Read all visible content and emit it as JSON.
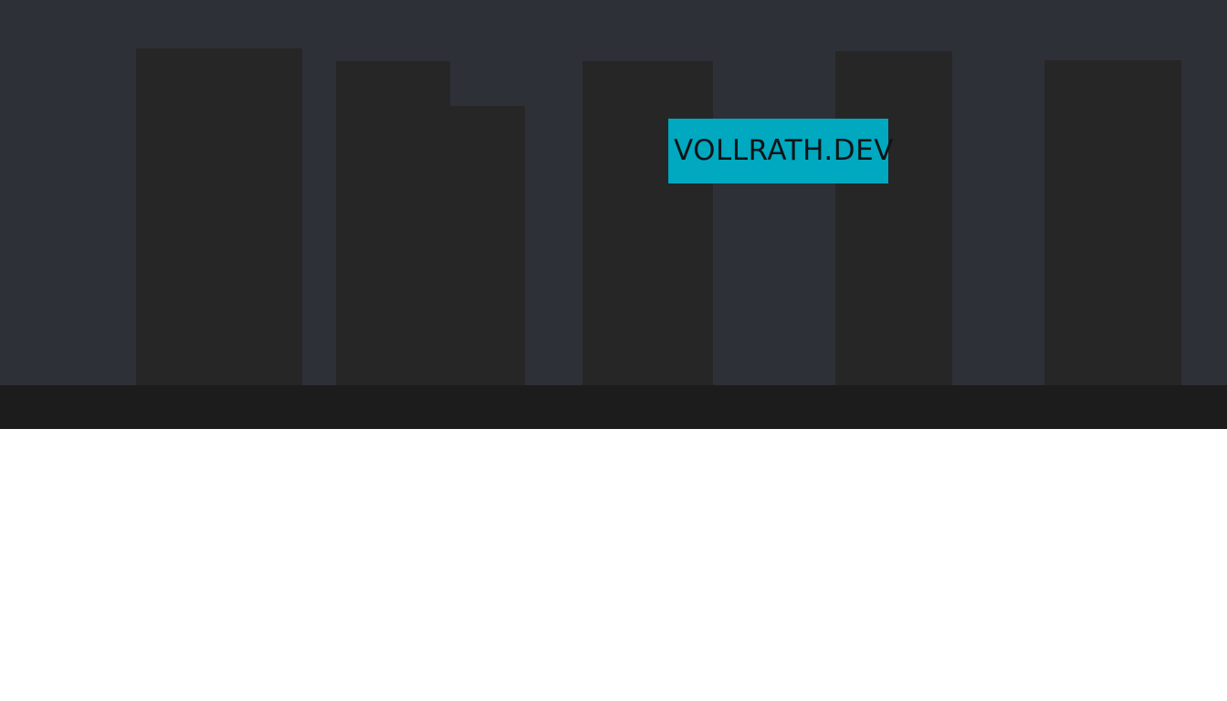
{
  "header": {
    "logo_text": "VOLLRATH.DEV"
  },
  "colors": {
    "sky": "#2e3038",
    "buildings": "#262626",
    "ground": "#1c1c1c",
    "logo_background": "#00a8c0",
    "logo_text": "#0f1416",
    "page_background": "#ffffff"
  }
}
